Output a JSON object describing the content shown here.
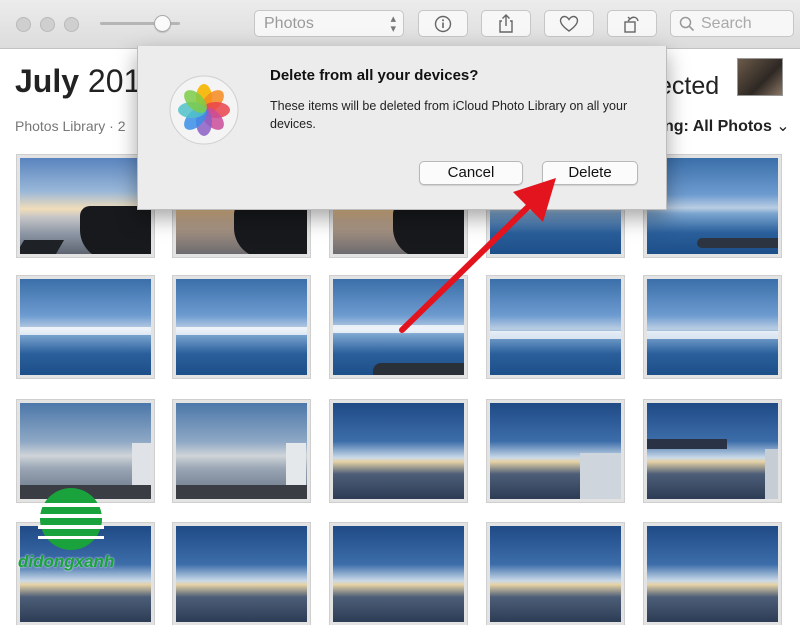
{
  "toolbar": {
    "view_select": "Photos",
    "search_placeholder": "Search",
    "icons": [
      "info-icon",
      "share-icon",
      "heart-icon",
      "rotate-icon",
      "search-icon"
    ]
  },
  "header": {
    "title_bold": "July",
    "title_rest": " 201",
    "subtitle": "Photos Library · 2",
    "selected_text": "ected",
    "showing_label": "ng: ",
    "showing_value": "All Photos"
  },
  "dialog": {
    "title": "Delete from all your devices?",
    "message": "These items will be deleted from iCloud Photo Library on all your devices.",
    "cancel_label": "Cancel",
    "delete_label": "Delete"
  },
  "annotation": {
    "arrow_color": "#e3141e"
  },
  "watermark": {
    "text": "didongxanh",
    "color": "#1aa23c"
  }
}
